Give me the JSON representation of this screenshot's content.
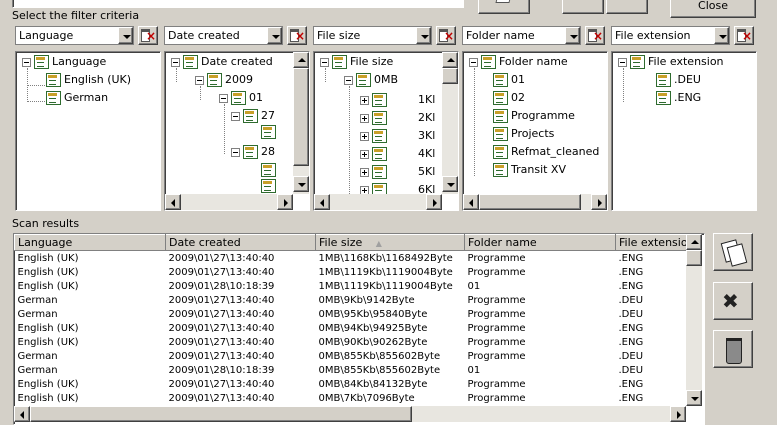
{
  "top": {
    "close_label": "Close"
  },
  "filter_section": {
    "title": "Select the filter criteria",
    "combos": [
      {
        "value": "Language"
      },
      {
        "value": "Date created"
      },
      {
        "value": "File size"
      },
      {
        "value": "Folder name"
      },
      {
        "value": "File extension"
      }
    ]
  },
  "trees": {
    "language": {
      "root": "Language",
      "children": [
        "English (UK)",
        "German"
      ]
    },
    "date": {
      "root": "Date created",
      "year": "2009",
      "month": "01",
      "day1": "27",
      "day2": "28"
    },
    "size": {
      "root": "File size",
      "mb": "0MB",
      "kb": [
        "1Kl",
        "2Kl",
        "3Kl",
        "4Kl",
        "5Kl",
        "6Kl"
      ]
    },
    "folder": {
      "root": "Folder name",
      "children": [
        "01",
        "02",
        "Programme",
        "Projects",
        "Refmat_cleaned",
        "Transit XV"
      ]
    },
    "ext": {
      "root": "File extension",
      "children": [
        ".DEU",
        ".ENG"
      ]
    }
  },
  "results": {
    "title": "Scan results",
    "columns": [
      "Language",
      "Date created",
      "File size",
      "Folder name",
      "File extension"
    ],
    "sort_indicator": "▲",
    "rows": [
      [
        "English (UK)",
        "2009\\01\\27\\13:40:40",
        "1MB\\1168Kb\\1168492Byte",
        "Programme",
        ".ENG"
      ],
      [
        "English (UK)",
        "2009\\01\\27\\13:40:40",
        "1MB\\1119Kb\\1119004Byte",
        "Programme",
        ".ENG"
      ],
      [
        "English (UK)",
        "2009\\01\\28\\10:18:39",
        "1MB\\1119Kb\\1119004Byte",
        "01",
        ".ENG"
      ],
      [
        "German",
        "2009\\01\\27\\13:40:40",
        "0MB\\9Kb\\9142Byte",
        "Programme",
        ".DEU"
      ],
      [
        "German",
        "2009\\01\\27\\13:40:40",
        "0MB\\95Kb\\95840Byte",
        "Programme",
        ".DEU"
      ],
      [
        "English (UK)",
        "2009\\01\\27\\13:40:40",
        "0MB\\94Kb\\94925Byte",
        "Programme",
        ".ENG"
      ],
      [
        "English (UK)",
        "2009\\01\\27\\13:40:40",
        "0MB\\90Kb\\90262Byte",
        "Programme",
        ".ENG"
      ],
      [
        "German",
        "2009\\01\\27\\13:40:40",
        "0MB\\855Kb\\855602Byte",
        "Programme",
        ".DEU"
      ],
      [
        "German",
        "2009\\01\\28\\10:18:39",
        "0MB\\855Kb\\855602Byte",
        "01",
        ".DEU"
      ],
      [
        "English (UK)",
        "2009\\01\\27\\13:40:40",
        "0MB\\84Kb\\84132Byte",
        "Programme",
        ".ENG"
      ],
      [
        "English (UK)",
        "2009\\01\\27\\13:40:40",
        "0MB\\7Kb\\7096Byte",
        "Programme",
        ".ENG"
      ]
    ]
  },
  "icons": {
    "copy": "copy-files-icon",
    "tools": "tools-icon",
    "trash": "trash-icon",
    "clear_filter": "clear-filter-icon"
  }
}
